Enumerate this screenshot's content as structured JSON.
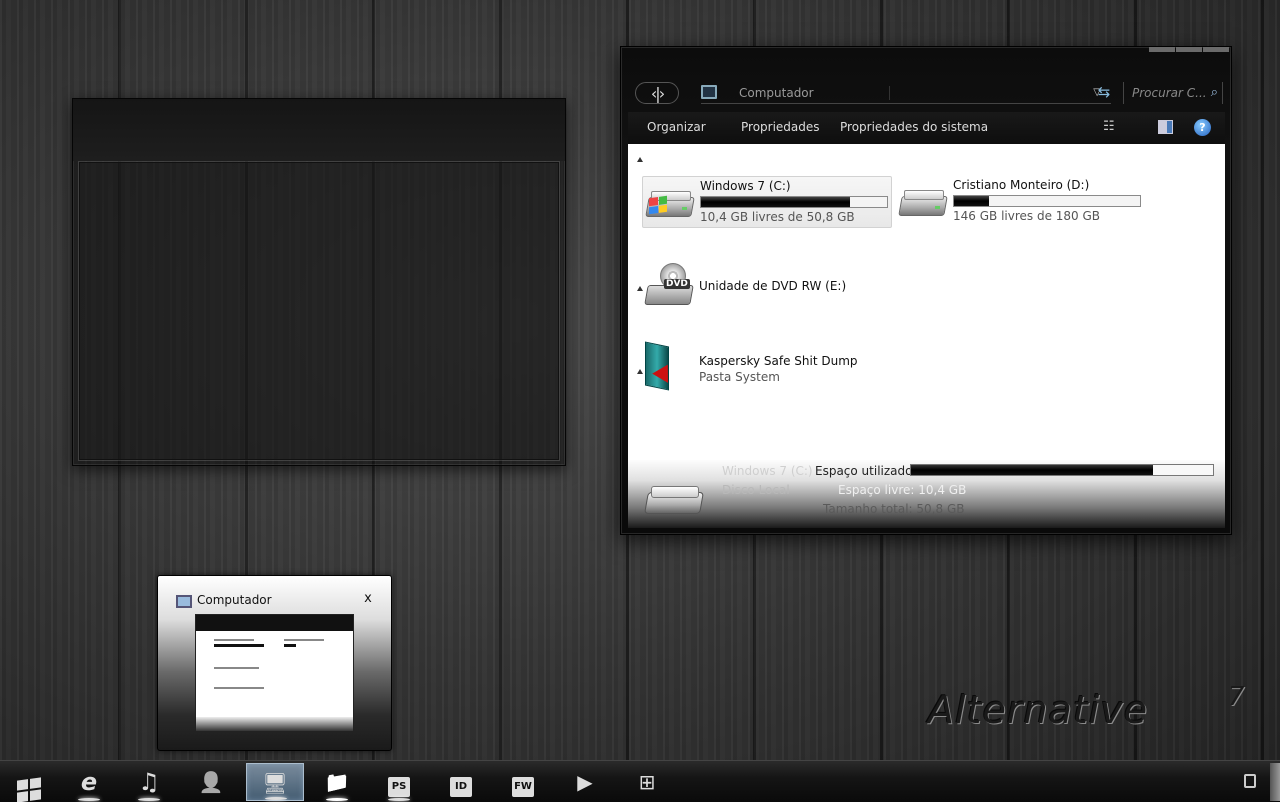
{
  "explorer": {
    "address": "Computador",
    "search_placeholder": "Procurar C...",
    "toolbar": {
      "organize": "Organizar",
      "properties": "Propriedades",
      "system_properties": "Propriedades do sistema"
    },
    "drives": [
      {
        "name": "Windows 7 (C:)",
        "free": "10,4 GB livres de 50,8 GB",
        "used_fraction": 0.8
      },
      {
        "name": "Cristiano Monteiro (D:)",
        "free": "146 GB livres de 180 GB",
        "used_fraction": 0.19
      }
    ],
    "dvd": {
      "name": "Unidade de DVD RW (E:)",
      "label": "DVD"
    },
    "folder": {
      "name": "Kaspersky Safe Shit Dump",
      "type": "Pasta System"
    },
    "details": {
      "name": "Windows 7 (C:)",
      "type": "Disco Local",
      "used_label": "Espaço utilizado:",
      "free_label": "Espaço livre: 10,4 GB",
      "total_label": "Tamanho total: 50,8 GB",
      "used_fraction": 0.8
    }
  },
  "thumbnail": {
    "title": "Computador",
    "close": "x"
  },
  "brand": {
    "text": "Alternative",
    "sup": "7"
  },
  "taskbar": {
    "items": [
      {
        "name": "start-button",
        "icon": "windows-flag-icon"
      },
      {
        "name": "internet-explorer",
        "icon": "internet-explorer-icon",
        "glyph": "e"
      },
      {
        "name": "music-player",
        "icon": "music-note-icon",
        "glyph": "♫"
      },
      {
        "name": "user",
        "icon": "user-icon",
        "glyph": "👤"
      },
      {
        "name": "computer",
        "icon": "computer-icon",
        "glyph": "🖥"
      },
      {
        "name": "folder",
        "icon": "folder-icon",
        "glyph": "📁"
      },
      {
        "name": "photoshop",
        "icon": "photoshop-icon",
        "glyph": "PS"
      },
      {
        "name": "indesign",
        "icon": "indesign-icon",
        "glyph": "ID"
      },
      {
        "name": "fireworks",
        "icon": "fireworks-icon",
        "glyph": "FW"
      },
      {
        "name": "media-play",
        "icon": "play-icon",
        "glyph": "▶"
      },
      {
        "name": "crop-tool",
        "icon": "crop-plus-icon",
        "glyph": "⊞"
      }
    ]
  }
}
